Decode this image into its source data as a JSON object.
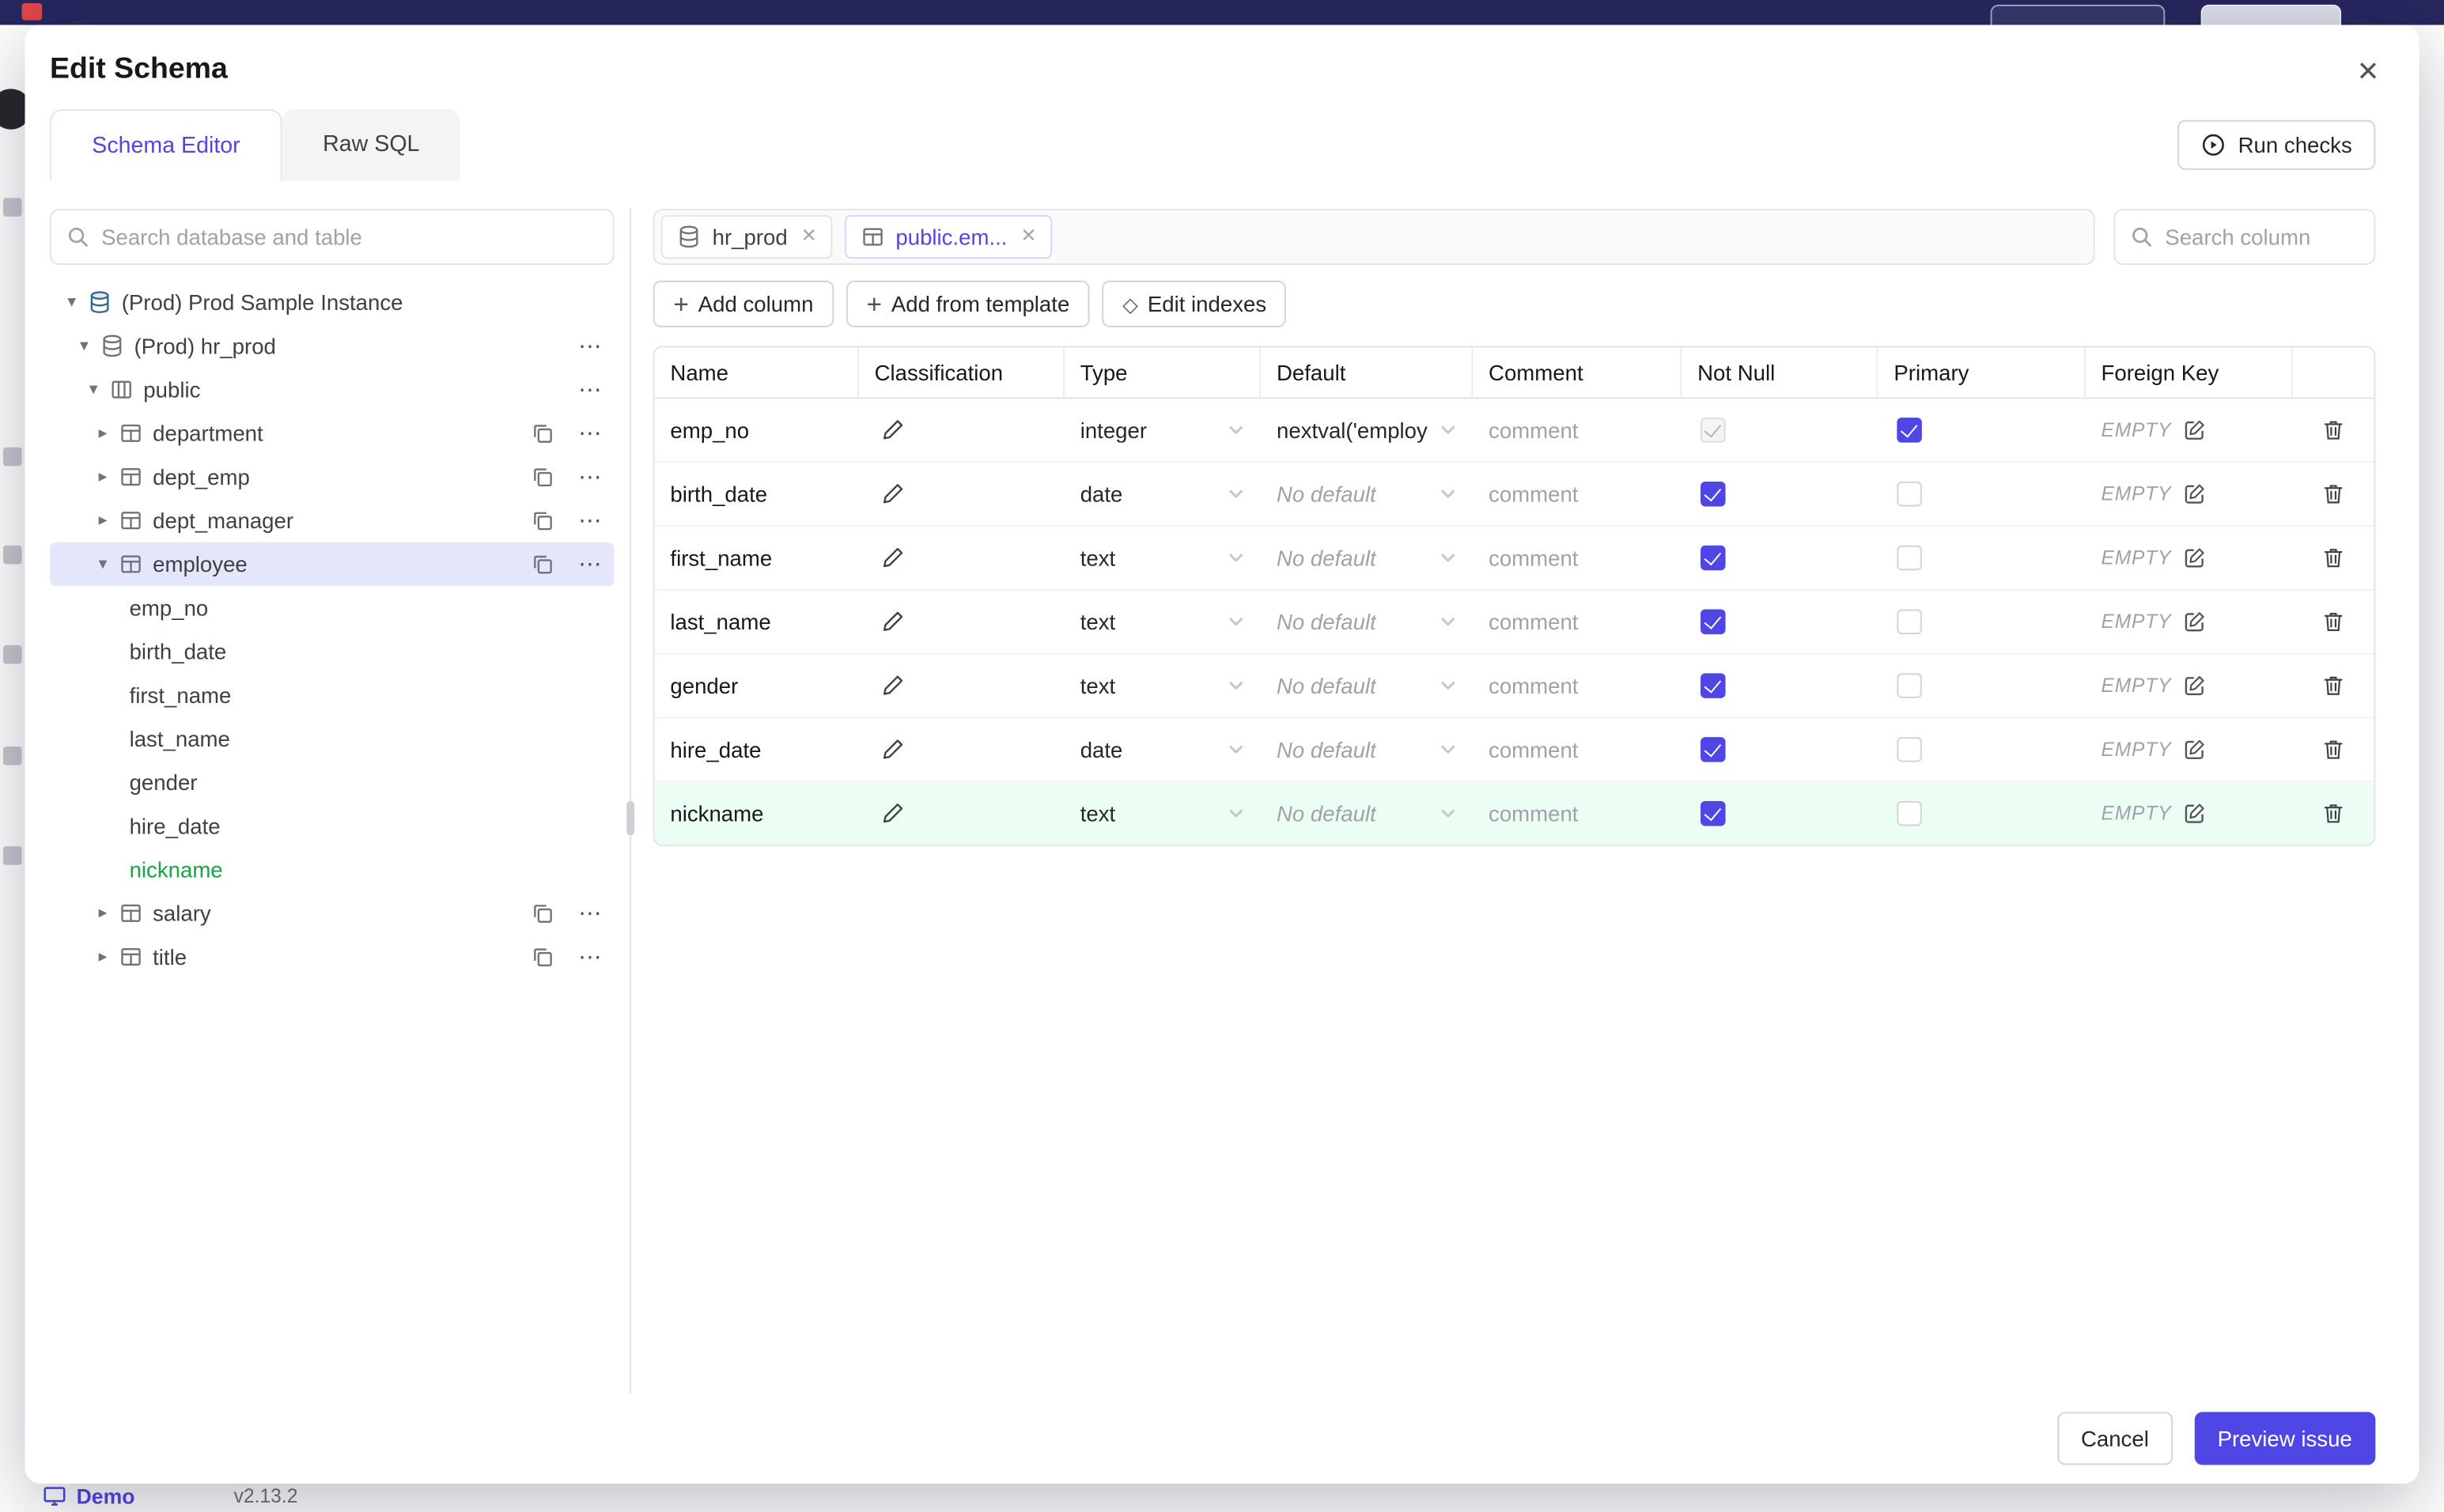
{
  "accent": "#4f46e5",
  "icons": {
    "caret_down": "▾",
    "caret_right": "▸",
    "more": "⋯",
    "close": "×",
    "plus": "+",
    "diamond": "◇"
  },
  "page": {
    "demo_label": "Demo",
    "version": "v2.13.2"
  },
  "modal": {
    "title": "Edit Schema",
    "tabs": [
      {
        "label": "Schema Editor",
        "active": true
      },
      {
        "label": "Raw SQL",
        "active": false
      }
    ],
    "run_checks_label": "Run checks",
    "sidebar": {
      "search_placeholder": "Search database and table",
      "items": [
        {
          "label": "(Prod) Prod Sample Instance",
          "icon": "postgres",
          "caret": "down",
          "level": 0
        },
        {
          "label": "(Prod) hr_prod",
          "icon": "database",
          "caret": "down",
          "level": 1,
          "more": true
        },
        {
          "label": "public",
          "icon": "schema",
          "caret": "down",
          "level": 2,
          "more": true
        },
        {
          "label": "department",
          "icon": "table",
          "caret": "right",
          "level": 3,
          "copy": true,
          "more": true
        },
        {
          "label": "dept_emp",
          "icon": "table",
          "caret": "right",
          "level": 3,
          "copy": true,
          "more": true
        },
        {
          "label": "dept_manager",
          "icon": "table",
          "caret": "right",
          "level": 3,
          "copy": true,
          "more": true
        },
        {
          "label": "employee",
          "icon": "table",
          "caret": "down",
          "level": 3,
          "copy": true,
          "more": true,
          "selected": true
        },
        {
          "label": "emp_no",
          "level": 4,
          "column": true
        },
        {
          "label": "birth_date",
          "level": 4,
          "column": true
        },
        {
          "label": "first_name",
          "level": 4,
          "column": true
        },
        {
          "label": "last_name",
          "level": 4,
          "column": true
        },
        {
          "label": "gender",
          "level": 4,
          "column": true
        },
        {
          "label": "hire_date",
          "level": 4,
          "column": true
        },
        {
          "label": "nickname",
          "level": 4,
          "column": true,
          "new": true
        },
        {
          "label": "salary",
          "icon": "table",
          "caret": "right",
          "level": 3,
          "copy": true,
          "more": true
        },
        {
          "label": "title",
          "icon": "table",
          "caret": "right",
          "level": 3,
          "copy": true,
          "more": true
        }
      ]
    },
    "editor": {
      "chips": [
        {
          "label": "hr_prod",
          "icon": "database",
          "active": false
        },
        {
          "label": "public.em...",
          "icon": "table",
          "active": true
        }
      ],
      "column_search_placeholder": "Search column",
      "actions": [
        {
          "label": "Add column",
          "icon": "plus"
        },
        {
          "label": "Add from template",
          "icon": "plus"
        },
        {
          "label": "Edit indexes",
          "icon": "diamond"
        }
      ],
      "table": {
        "headers": [
          "Name",
          "Classification",
          "Type",
          "Default",
          "Comment",
          "Not Null",
          "Primary",
          "Foreign Key"
        ],
        "comment_placeholder": "comment",
        "foreign_key_empty": "EMPTY",
        "rows": [
          {
            "name": "emp_no",
            "type": "integer",
            "default": "nextval('employ",
            "default_is_placeholder": false,
            "not_null_checked": true,
            "not_null_disabled": true,
            "primary_checked": true,
            "highlight": false
          },
          {
            "name": "birth_date",
            "type": "date",
            "default": "No default",
            "default_is_placeholder": true,
            "not_null_checked": true,
            "not_null_disabled": false,
            "primary_checked": false,
            "highlight": false
          },
          {
            "name": "first_name",
            "type": "text",
            "default": "No default",
            "default_is_placeholder": true,
            "not_null_checked": true,
            "not_null_disabled": false,
            "primary_checked": false,
            "highlight": false
          },
          {
            "name": "last_name",
            "type": "text",
            "default": "No default",
            "default_is_placeholder": true,
            "not_null_checked": true,
            "not_null_disabled": false,
            "primary_checked": false,
            "highlight": false
          },
          {
            "name": "gender",
            "type": "text",
            "default": "No default",
            "default_is_placeholder": true,
            "not_null_checked": true,
            "not_null_disabled": false,
            "primary_checked": false,
            "highlight": false
          },
          {
            "name": "hire_date",
            "type": "date",
            "default": "No default",
            "default_is_placeholder": true,
            "not_null_checked": true,
            "not_null_disabled": false,
            "primary_checked": false,
            "highlight": false
          },
          {
            "name": "nickname",
            "type": "text",
            "default": "No default",
            "default_is_placeholder": true,
            "not_null_checked": true,
            "not_null_disabled": false,
            "primary_checked": false,
            "highlight": true
          }
        ]
      }
    },
    "footer": {
      "cancel_label": "Cancel",
      "primary_label": "Preview issue"
    }
  }
}
